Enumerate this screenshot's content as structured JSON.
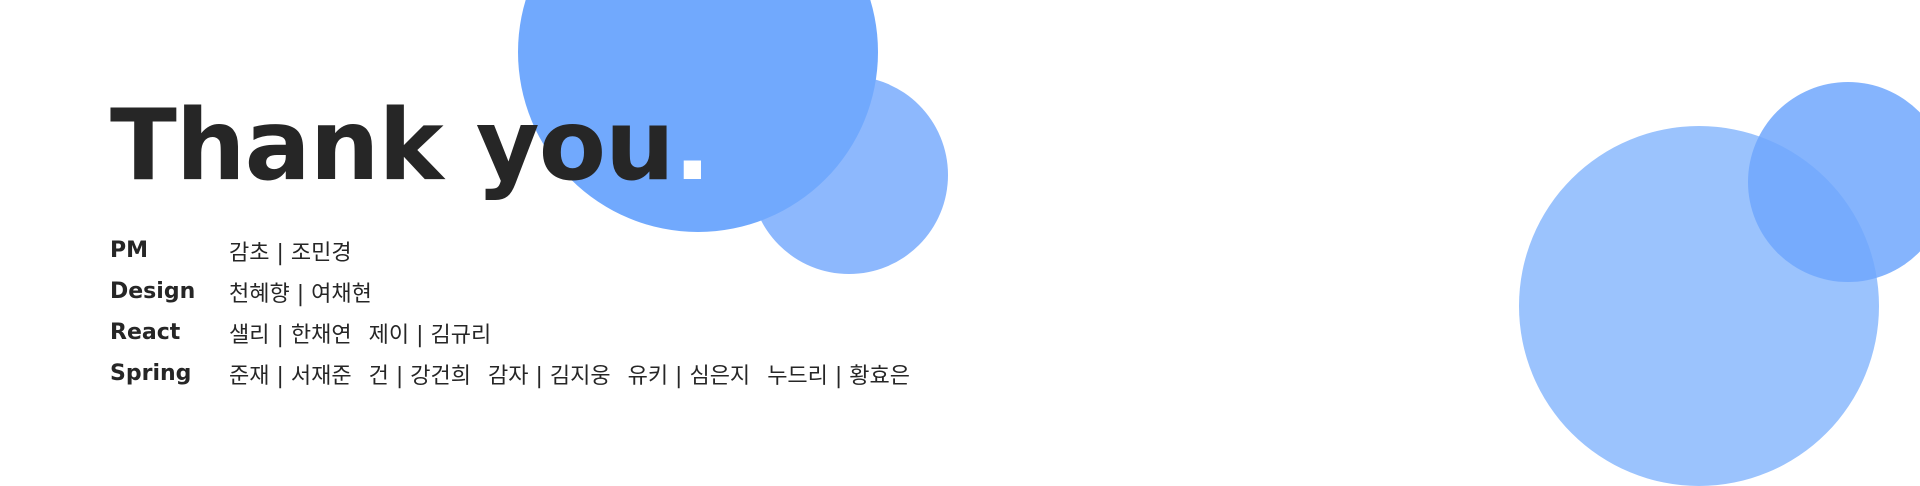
{
  "title": {
    "text": "Thank you",
    "dot": "."
  },
  "team": [
    {
      "role": "PM",
      "members": [
        "감초 | 조민경"
      ]
    },
    {
      "role": "Design",
      "members": [
        "천혜향 | 여채현"
      ]
    },
    {
      "role": "React",
      "members": [
        "샐리 | 한채연",
        "제이 | 김규리"
      ]
    },
    {
      "role": "Spring",
      "members": [
        "준재 | 서재준",
        "건 | 강건희",
        "감자 | 김지웅",
        "유키 | 심은지",
        "누드리 | 황효은"
      ]
    }
  ],
  "colors": {
    "text": "#262626",
    "circle_primary": "#71a9fd",
    "circle_light": "#8db8fd",
    "circle_lighter": "#9bc3fd"
  }
}
